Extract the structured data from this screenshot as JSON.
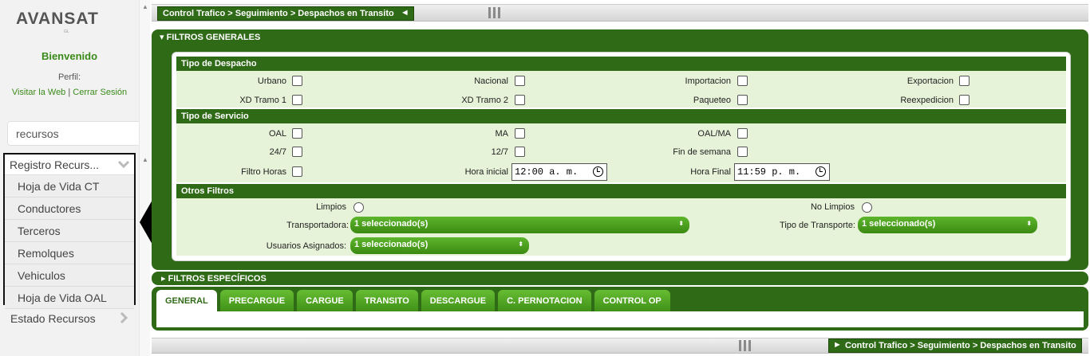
{
  "sidebar": {
    "logo_text": "AVANSAT",
    "logo_sub": "GL",
    "welcome": "Bienvenido",
    "profile_label": "Perfil:",
    "link_visit": "Visitar la Web",
    "link_separator": " | ",
    "link_logout": "Cerrar Sesión",
    "search_value": "recursos",
    "menu_group": "Registro Recurs...",
    "menu_items": [
      "Hoja de Vida CT",
      "Conductores",
      "Terceros",
      "Remolques",
      "Vehiculos",
      "Hoja de Vida OAL"
    ],
    "next_group": "Estado Recursos"
  },
  "breadcrumb": {
    "text": "Control Trafico > Seguimiento > Despachos en Transito",
    "collapse_glyph": "◄",
    "expand_glyph": "►"
  },
  "filtros_generales": {
    "title": "▾ FILTROS GENERALES",
    "tipo_despacho": {
      "title": "Tipo de Despacho",
      "options": [
        "Urbano",
        "Nacional",
        "Importacion",
        "Exportacion",
        "XD Tramo 1",
        "XD Tramo 2",
        "Paqueteo",
        "Reexpedicion"
      ]
    },
    "tipo_servicio": {
      "title": "Tipo de Servicio",
      "options": [
        "OAL",
        "MA",
        "OAL/MA",
        "24/7",
        "12/7",
        "Fin de semana"
      ],
      "filtro_horas": "Filtro Horas",
      "hora_inicial_label": "Hora inicial",
      "hora_inicial": "12:00 a. m.",
      "hora_final_label": "Hora Final",
      "hora_final": "11:59 p. m."
    },
    "otros": {
      "title": "Otros Filtros",
      "limpios": "Limpios",
      "no_limpios": "No Limpios",
      "transportadora_label": "Transportadora:",
      "transportadora_value": "1 seleccionado(s)",
      "tipo_transporte_label": "Tipo de Transporte:",
      "tipo_transporte_value": "1 seleccionado(s)",
      "usuarios_label": "Usuarios Asignados:",
      "usuarios_value": "1 seleccionado(s)"
    }
  },
  "filtros_especificos": {
    "title": "▸ FILTROS ESPECÍFICOS"
  },
  "tabs": [
    "GENERAL",
    "PRECARGUE",
    "CARGUE",
    "TRANSITO",
    "DESCARGUE",
    "C. PERNOTACION",
    "CONTROL OP"
  ],
  "colors": {
    "brand_green": "#2f6a17",
    "panel_light": "#e6f3d8",
    "select_green": "#4ca21f"
  }
}
